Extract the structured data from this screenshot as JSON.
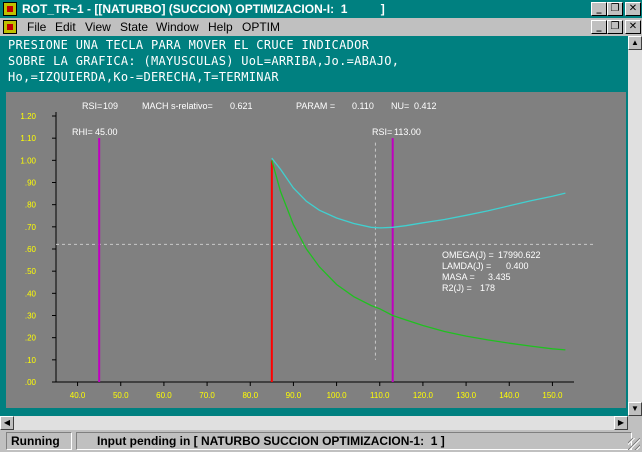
{
  "window": {
    "title": "ROT_TR~1 - [[NATURBO] (SUCCION) OPTIMIZACION-I:  1          ]"
  },
  "menu": {
    "items": [
      {
        "label": "File"
      },
      {
        "label": "Edit"
      },
      {
        "label": "View"
      },
      {
        "label": "State"
      },
      {
        "label": "Window"
      },
      {
        "label": "Help"
      },
      {
        "label": "OPTIM"
      }
    ]
  },
  "instructions": {
    "line1": "PRESIONE UNA TECLA PARA MOVER EL CRUCE INDICADOR",
    "line2": "SOBRE LA GRAFICA: (MAYUSCULAS) UoL=ARRIBA,Jo.=ABAJO,",
    "line3": "Ho,=IZQUIERDA,Ko-=DERECHA,T=TERMINAR"
  },
  "chart_header": {
    "rsi_label": "RSI=",
    "rsi_value": "109",
    "mach_label": "MACH s-relativo=",
    "mach_value": "0.621",
    "param_label": "PARAM =",
    "param_value": "0.110",
    "nu_label": "NU=",
    "nu_value": "0.412"
  },
  "markers": {
    "rhi_label": "RHI=",
    "rhi_value": "45.00",
    "rsi_label": "RSI=",
    "rsi_value": "113.00"
  },
  "readout": {
    "omega_label": "OMEGA(J) =",
    "omega_value": "17990.622",
    "lamda_label": "LAMDA(J) =",
    "lamda_value": "0.400",
    "masa_label": "MASA =",
    "masa_value": "3.435",
    "r2_label": "R2(J) =",
    "r2_value": "178"
  },
  "chart_data": {
    "type": "line",
    "xlim": [
      35,
      155
    ],
    "ylim": [
      0,
      1.2
    ],
    "xticks": [
      "40.0",
      "50.0",
      "60.0",
      "70.0",
      "80.0",
      "90.0",
      "100.0",
      "110.0",
      "120.0",
      "130.0",
      "140.0",
      "150.0"
    ],
    "yticks": [
      ".00",
      ".10",
      ".20",
      ".30",
      ".40",
      ".50",
      ".60",
      ".70",
      ".80",
      ".90",
      "1.00",
      "1.10",
      "1.20"
    ],
    "vlines": [
      {
        "x": 45,
        "y_top": 1.1,
        "color": "#c000c0"
      },
      {
        "x": 85,
        "y_top": 1.0,
        "color": "#ff0000"
      },
      {
        "x": 113,
        "y_top": 1.1,
        "color": "#c000c0"
      }
    ],
    "crosshair": {
      "x": 109,
      "y": 0.621,
      "y_range": [
        0.1,
        1.08
      ]
    },
    "series": [
      {
        "color": "#40d0d0",
        "x": [
          85,
          87,
          90,
          93,
          96,
          100,
          104,
          108,
          110,
          113,
          116,
          120,
          125,
          130,
          135,
          140,
          145,
          150,
          153
        ],
        "y": [
          1.01,
          0.96,
          0.875,
          0.815,
          0.775,
          0.74,
          0.715,
          0.698,
          0.695,
          0.698,
          0.705,
          0.718,
          0.733,
          0.752,
          0.772,
          0.795,
          0.818,
          0.838,
          0.852
        ]
      },
      {
        "color": "#20c020",
        "x": [
          85,
          87,
          90,
          93,
          96,
          100,
          104,
          108,
          110,
          113,
          116,
          120,
          125,
          130,
          135,
          140,
          145,
          150,
          153
        ],
        "y": [
          1.0,
          0.86,
          0.71,
          0.6,
          0.52,
          0.44,
          0.385,
          0.345,
          0.33,
          0.3,
          0.28,
          0.255,
          0.228,
          0.207,
          0.19,
          0.175,
          0.162,
          0.15,
          0.145
        ]
      }
    ]
  },
  "status": {
    "state": "Running",
    "message": "Input pending in [ NATURBO SUCCION OPTIMIZACION-1:  1 ]"
  }
}
